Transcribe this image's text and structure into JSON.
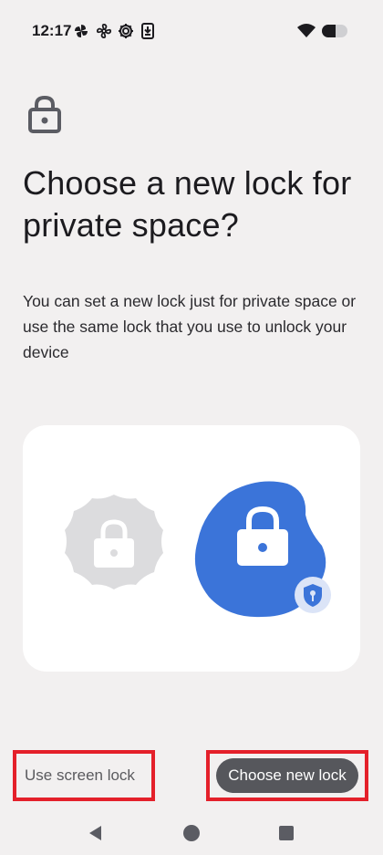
{
  "status_bar": {
    "time": "12:17",
    "left_icons": [
      "pinwheel-icon",
      "fan-icon",
      "gear-icon",
      "download-icon"
    ],
    "right_icons": [
      "wifi-icon",
      "battery-icon"
    ]
  },
  "header": {
    "icon": "lock-icon",
    "title": "Choose a new lock for private space?",
    "description": "You can set a new lock just for private space or use the same lock that you use to unlock your device"
  },
  "illustration": {
    "left_icon": "grey-lock-badge-icon",
    "right_icon": "blue-lock-blob-icon",
    "badge_icon": "shield-key-icon",
    "colors": {
      "grey": "#dcdcde",
      "blue": "#3b74d9",
      "card": "#ffffff"
    }
  },
  "actions": {
    "secondary_label": "Use screen lock",
    "primary_label": "Choose new lock",
    "highlight_color": "#e4202a"
  },
  "nav_bar": {
    "back_icon": "back-triangle-icon",
    "home_icon": "home-circle-icon",
    "recents_icon": "recents-square-icon"
  }
}
